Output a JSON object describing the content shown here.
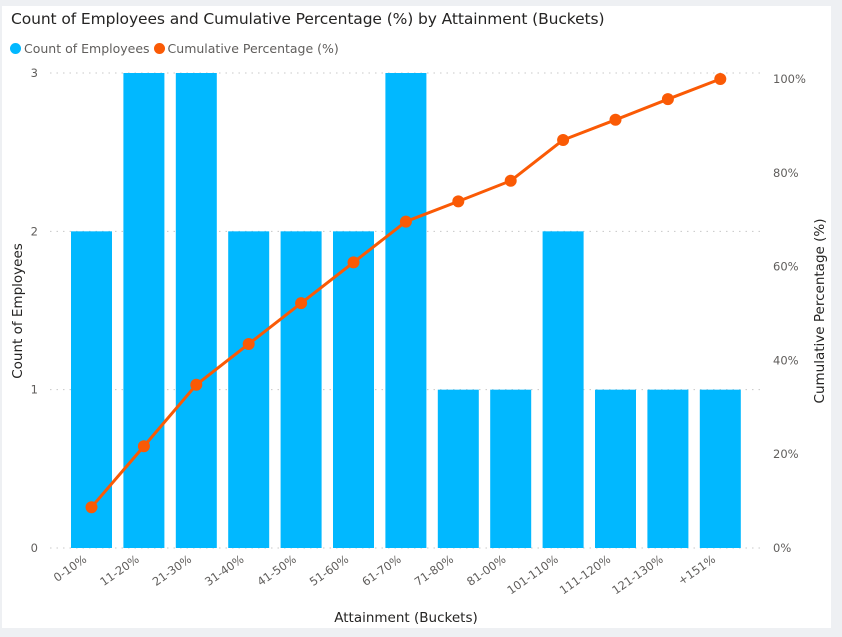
{
  "colors": {
    "bars": "#01B8FF",
    "line": "#FA5A05",
    "grid": "#c8c8c8",
    "tick_text": "#605e5c"
  },
  "chart_data": {
    "type": "bar+line",
    "title": "Count of Employees and Cumulative Percentage (%) by Attainment (Buckets)",
    "xlabel": "Attainment (Buckets)",
    "ylabel": "Count of Employees",
    "y2label": "Cumulative Percentage (%)",
    "legend_position": "top-left",
    "legend": [
      {
        "label": "Count of Employees",
        "color": "#01B8FF"
      },
      {
        "label": "Cumulative Percentage (%)",
        "color": "#FA5A05"
      }
    ],
    "categories": [
      "0-10%",
      "11-20%",
      "21-30%",
      "31-40%",
      "41-50%",
      "51-60%",
      "61-70%",
      "71-80%",
      "81-00%",
      "101-110%",
      "111-120%",
      "121-130%",
      "+151%"
    ],
    "series": [
      {
        "name": "Count of Employees",
        "type": "bar",
        "axis": "left",
        "values": [
          2,
          3,
          3,
          2,
          2,
          2,
          3,
          1,
          1,
          2,
          1,
          1,
          1
        ]
      },
      {
        "name": "Cumulative Percentage (%)",
        "type": "line",
        "axis": "right",
        "values": [
          8.7,
          21.7,
          34.8,
          43.5,
          52.2,
          60.9,
          69.6,
          73.9,
          78.3,
          87.0,
          91.3,
          95.7,
          100.0
        ]
      }
    ],
    "ylim": [
      0,
      3
    ],
    "yticks": [
      0,
      1,
      2,
      3
    ],
    "y2lim": [
      0,
      100
    ],
    "y2ticks": [
      "0%",
      "20%",
      "40%",
      "60%",
      "80%",
      "100%"
    ],
    "y2tick_values": [
      0,
      20,
      40,
      60,
      80,
      100
    ],
    "grid": true
  }
}
